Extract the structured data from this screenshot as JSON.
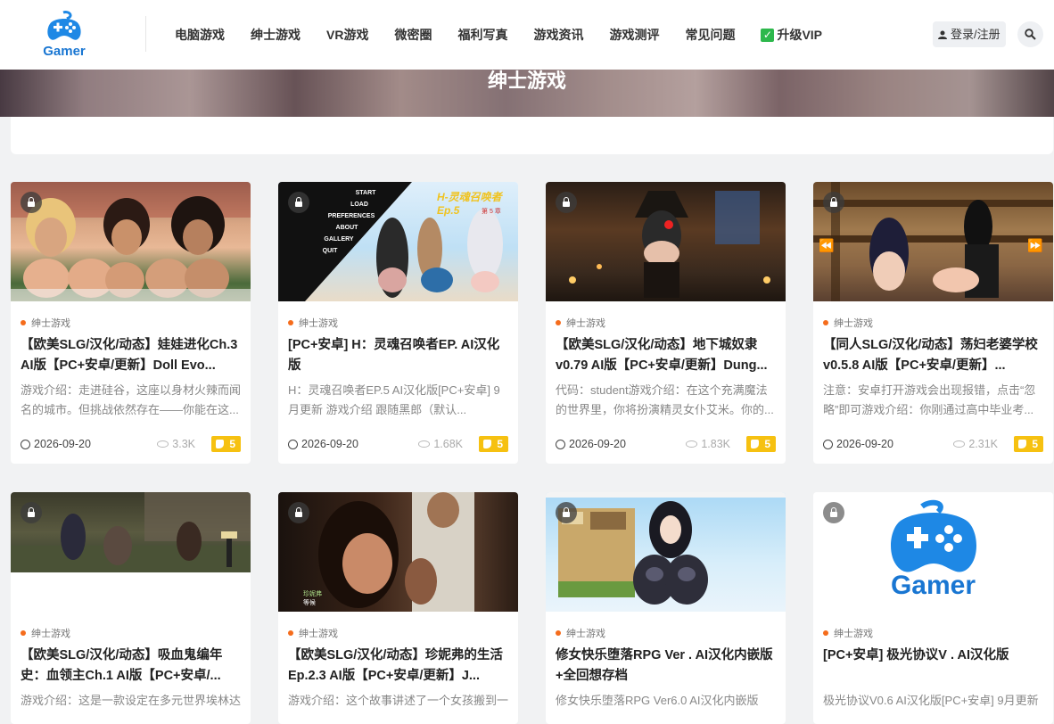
{
  "header": {
    "logo_text": "Gamer",
    "nav": [
      "电脑游戏",
      "绅士游戏",
      "VR游戏",
      "微密圈",
      "福利写真",
      "游戏资讯",
      "游戏测评",
      "常见问题"
    ],
    "vip_label": "升级VIP",
    "login_label": "登录/注册"
  },
  "banner": {
    "title": "绅士游戏"
  },
  "posts": [
    {
      "category": "绅士游戏",
      "title": "【欧美SLG/汉化/动态】娃娃进化Ch.3 AI版【PC+安卓/更新】Doll Evo...",
      "desc": "游戏介绍：走进硅谷，这座以身材火辣而闻名的城市。但挑战依然存在——你能在这...",
      "date": "2026-09-20",
      "views": "3.3K",
      "points": "5"
    },
    {
      "category": "绅士游戏",
      "title": "[PC+安卓] H：灵魂召唤者EP. AI汉化版",
      "desc": "H：灵魂召唤者EP.5 AI汉化版[PC+安卓] 9月更新 游戏介绍 跟随黑郎（默认...",
      "date": "2026-09-20",
      "views": "1.68K",
      "points": "5"
    },
    {
      "category": "绅士游戏",
      "title": "【欧美SLG/汉化/动态】地下城奴隶v0.79 AI版【PC+安卓/更新】Dung...",
      "desc": "代码：student游戏介绍：在这个充满魔法的世界里，你将扮演精灵女仆艾米。你的...",
      "date": "2026-09-20",
      "views": "1.83K",
      "points": "5"
    },
    {
      "category": "绅士游戏",
      "title": "【同人SLG/汉化/动态】荡妇老婆学校v0.5.8 AI版【PC+安卓/更新】...",
      "desc": "注意：安卓打开游戏会出现报错，点击“忽略”即可游戏介绍：你刚通过高中毕业考...",
      "date": "2026-09-20",
      "views": "2.31K",
      "points": "5"
    },
    {
      "category": "绅士游戏",
      "title": "【欧美SLG/汉化/动态】吸血鬼编年史：血领主Ch.1 AI版【PC+安卓/...",
      "desc": "游戏介绍：这是一款设定在多元世界埃林达",
      "date": "",
      "views": "",
      "points": ""
    },
    {
      "category": "绅士游戏",
      "title": "【欧美SLG/汉化/动态】珍妮弗的生活Ep.2.3 AI版【PC+安卓/更新】J...",
      "desc": "游戏介绍：这个故事讲述了一个女孩搬到一",
      "date": "",
      "views": "",
      "points": ""
    },
    {
      "category": "绅士游戏",
      "title": "修女快乐堕落RPG Ver . AI汉化内嵌版+全回想存档",
      "desc": "修女快乐堕落RPG Ver6.0 AI汉化内嵌版",
      "date": "",
      "views": "",
      "points": ""
    },
    {
      "category": "绅士游戏",
      "title": "[PC+安卓] 极光协议V . AI汉化版",
      "desc": "极光协议V0.6 AI汉化版[PC+安卓] 9月更新",
      "date": "",
      "views": "",
      "points": ""
    }
  ],
  "thumb_texts": {
    "post2_menu": [
      "START",
      "LOAD",
      "PREFERENCES",
      "ABOUT",
      "GALLERY",
      "QUIT"
    ],
    "post2_logo": "H-灵魂召唤者Ep.5",
    "post2_chapter": "第 5 章",
    "post8_logo": "Gamer"
  },
  "colors": {
    "accent_orange": "#f56c1c",
    "badge_yellow": "#f6c111",
    "brand_blue": "#1976d2",
    "vip_green": "#2db84c"
  }
}
